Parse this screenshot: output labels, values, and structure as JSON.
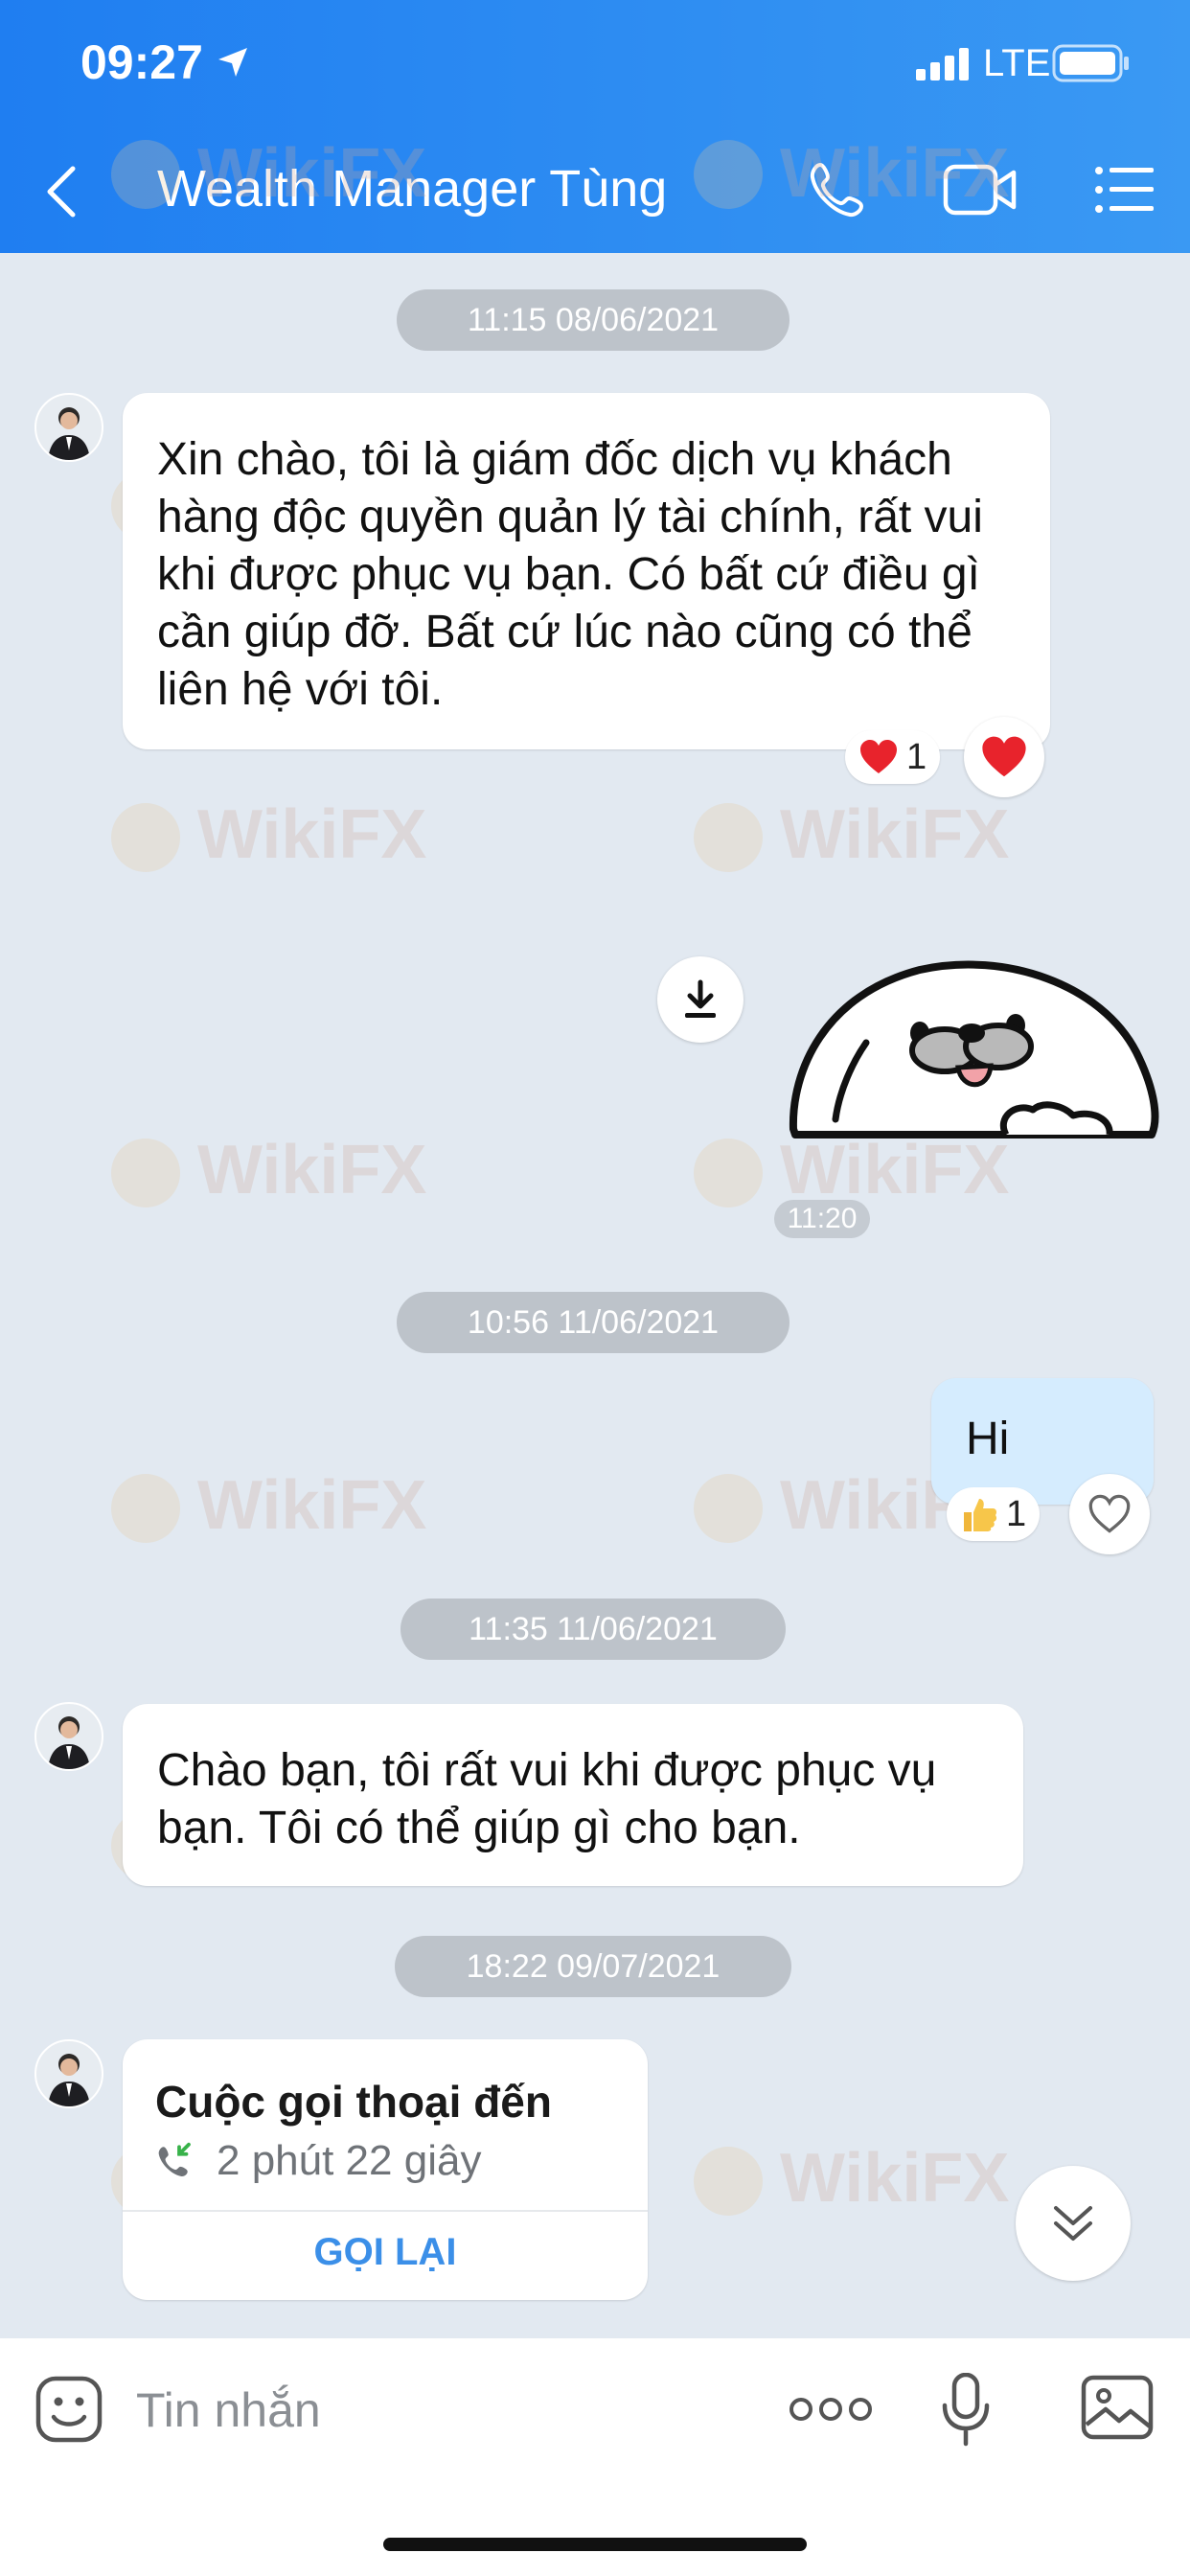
{
  "status_bar": {
    "time": "09:27",
    "network": "LTE"
  },
  "header": {
    "title": "Wealth Manager Tùng"
  },
  "watermark": "WikiFX",
  "messages": {
    "date1": "11:15 08/06/2021",
    "msg1": "Xin chào, tôi là giám đốc dịch vụ khách hàng độc quyền quản lý tài chính, rất vui khi được phục vụ bạn.  Có bất cứ điều gì cần giúp đỡ.  Bất cứ lúc nào cũng có thể liên hệ với tôi.",
    "msg1_reaction_count": "1",
    "sticker_time": "11:20",
    "date2": "10:56 11/06/2021",
    "msg2": "Hi",
    "msg2_reaction_count": "1",
    "date3": "11:35 11/06/2021",
    "msg3": "Chào bạn, tôi rất vui khi được phục vụ bạn. Tôi có thể giúp gì cho bạn.",
    "date4": "18:22 09/07/2021",
    "call": {
      "title": "Cuộc gọi thoại đến",
      "duration": "2 phút 22 giây",
      "action": "GỌI LẠI"
    }
  },
  "input": {
    "placeholder": "Tin nhắn"
  },
  "colors": {
    "header": "#2b8cf2",
    "background": "#e2e9f1",
    "outgoing_bubble": "#d5ecfe",
    "link": "#3b8fe8"
  },
  "icons": [
    "back-icon",
    "phone-icon",
    "video-icon",
    "menu-icon",
    "download-icon",
    "heart-icon",
    "thumbs-up-icon",
    "scroll-down-icon",
    "emoji-icon",
    "more-icon",
    "mic-icon",
    "image-icon",
    "incoming-call-icon"
  ]
}
